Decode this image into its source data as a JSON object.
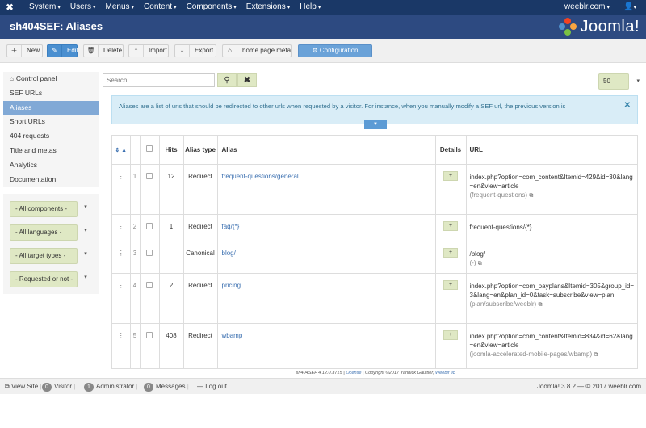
{
  "topbar": {
    "menu": [
      "System",
      "Users",
      "Menus",
      "Content",
      "Components",
      "Extensions",
      "Help"
    ],
    "site": "weeblr.com"
  },
  "title": "sh404SEF: Aliases",
  "brand": {
    "word": "Joomla!",
    "colors": [
      "#f44321",
      "#5091cd",
      "#f9a541",
      "#7ac143"
    ]
  },
  "toolbar": {
    "new": "New",
    "edit": "Edit",
    "delete": "Delete",
    "import": "Import",
    "export": "Export",
    "home_meta": "home page meta",
    "configuration": "Configuration"
  },
  "sidebar": {
    "items": [
      {
        "label": "Control panel"
      },
      {
        "label": "SEF URLs"
      },
      {
        "label": "Aliases"
      },
      {
        "label": "Short URLs"
      },
      {
        "label": "404 requests"
      },
      {
        "label": "Title and metas"
      },
      {
        "label": "Analytics"
      },
      {
        "label": "Documentation"
      }
    ],
    "filters": [
      "- All components -",
      "- All languages -",
      "- All target types -",
      "- Requested or not -"
    ]
  },
  "search": {
    "placeholder": "Search"
  },
  "limit": "50",
  "notice": "Aliases are a list of urls that should be redirected to other urls when requested by a visitor. For instance, when you manually modify a SEF url, the previous version is",
  "table": {
    "headers": {
      "hits": "Hits",
      "alias_type": "Alias type",
      "alias": "Alias",
      "details": "Details",
      "url": "URL"
    },
    "rows": [
      {
        "num": "1",
        "hits": "12",
        "type": "Redirect",
        "alias": "frequent-questions/general",
        "url": "index.php?option=com_content&Itemid=429&id=30&lang=en&view=article",
        "sub": "(frequent-questions)"
      },
      {
        "num": "2",
        "hits": "1",
        "type": "Redirect",
        "alias": "faq/{*}",
        "url": "frequent-questions/{*}",
        "sub": ""
      },
      {
        "num": "3",
        "hits": "",
        "type": "Canonical",
        "alias": "blog/",
        "url": "/blog/",
        "sub": "(-)"
      },
      {
        "num": "4",
        "hits": "2",
        "type": "Redirect",
        "alias": "pricing",
        "url": "index.php?option=com_payplans&Itemid=305&group_id=3&lang=en&plan_id=0&task=subscribe&view=plan",
        "sub": "(plan/subscribe/weeblr)"
      },
      {
        "num": "5",
        "hits": "408",
        "type": "Redirect",
        "alias": "wbamp",
        "url": "index.php?option=com_content&Itemid=834&id=62&lang=en&view=article",
        "sub": "(joomla-accelerated-mobile-pages/wbamp)"
      }
    ]
  },
  "footer_line": {
    "version": "sh404SEF 4.12.0.3715",
    "license": "License",
    "copyright": "Copyright ©2017 Yannick Gaultier,",
    "company": "Weeblr llc"
  },
  "statusbar": {
    "view_site": "View Site",
    "visitor_count": "0",
    "visitor": "Visitor",
    "admin_count": "1",
    "admin": "Administrator",
    "messages_count": "0",
    "messages": "Messages",
    "logout": "Log out",
    "version": "Joomla! 3.8.2 — © 2017 weeblr.com"
  }
}
